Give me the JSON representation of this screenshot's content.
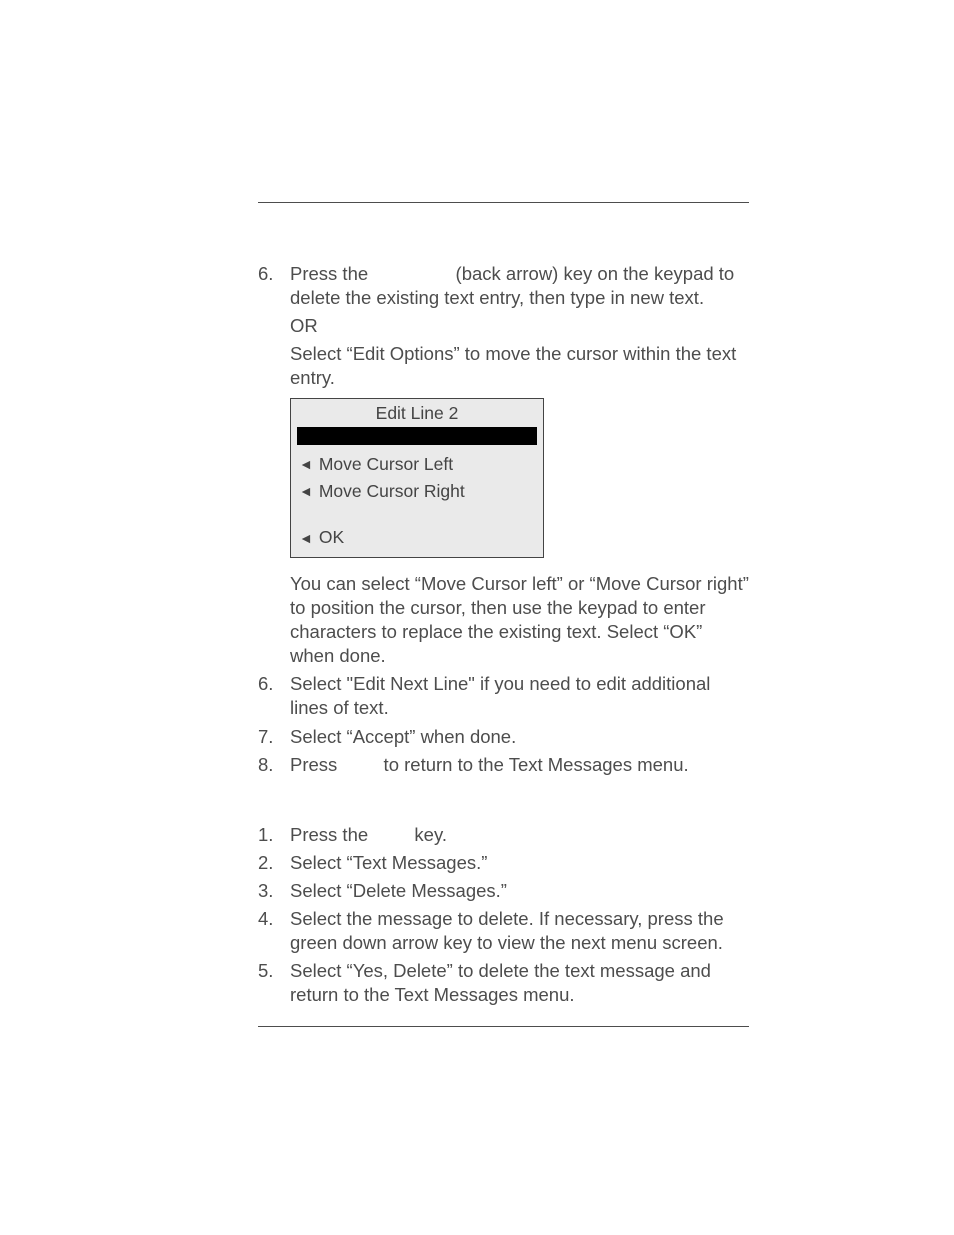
{
  "section1": {
    "step6a": {
      "num": "6.",
      "t1": "Press the ",
      "t2": " (back arrow) key on the keypad to delete the existing text entry, then type in new text.",
      "or": "OR",
      "t3": "Select “Edit Options” to move the cursor within the text entry.",
      "after": "You can select “Move Cursor left” or “Move Cursor right” to position the cursor, then use the keypad to enter characters to replace the existing text. Select “OK” when done."
    },
    "panel": {
      "title": "Edit Line 2",
      "row1": "Move Cursor Left",
      "row2": "Move Cursor Right",
      "row3": "OK"
    },
    "step6b": {
      "num": "6.",
      "text": "Select \"Edit Next Line\" if you need to edit additional lines of text."
    },
    "step7": {
      "num": "7.",
      "text": "Select “Accept” when done."
    },
    "step8": {
      "num": "8.",
      "t1": "Press ",
      "t2": " to return to the Text Messages menu."
    }
  },
  "section2": {
    "s1": {
      "num": "1.",
      "t1": "Press the ",
      "t2": " key."
    },
    "s2": {
      "num": "2.",
      "text": "Select “Text Messages.”"
    },
    "s3": {
      "num": "3.",
      "text": "Select “Delete Messages.”"
    },
    "s4": {
      "num": "4.",
      "text": "Select the message to delete. If necessary, press the green down arrow key to view the next menu screen."
    },
    "s5": {
      "num": "5.",
      "text": "Select “Yes, Delete” to delete the text message and return to the Text Messages menu."
    }
  }
}
